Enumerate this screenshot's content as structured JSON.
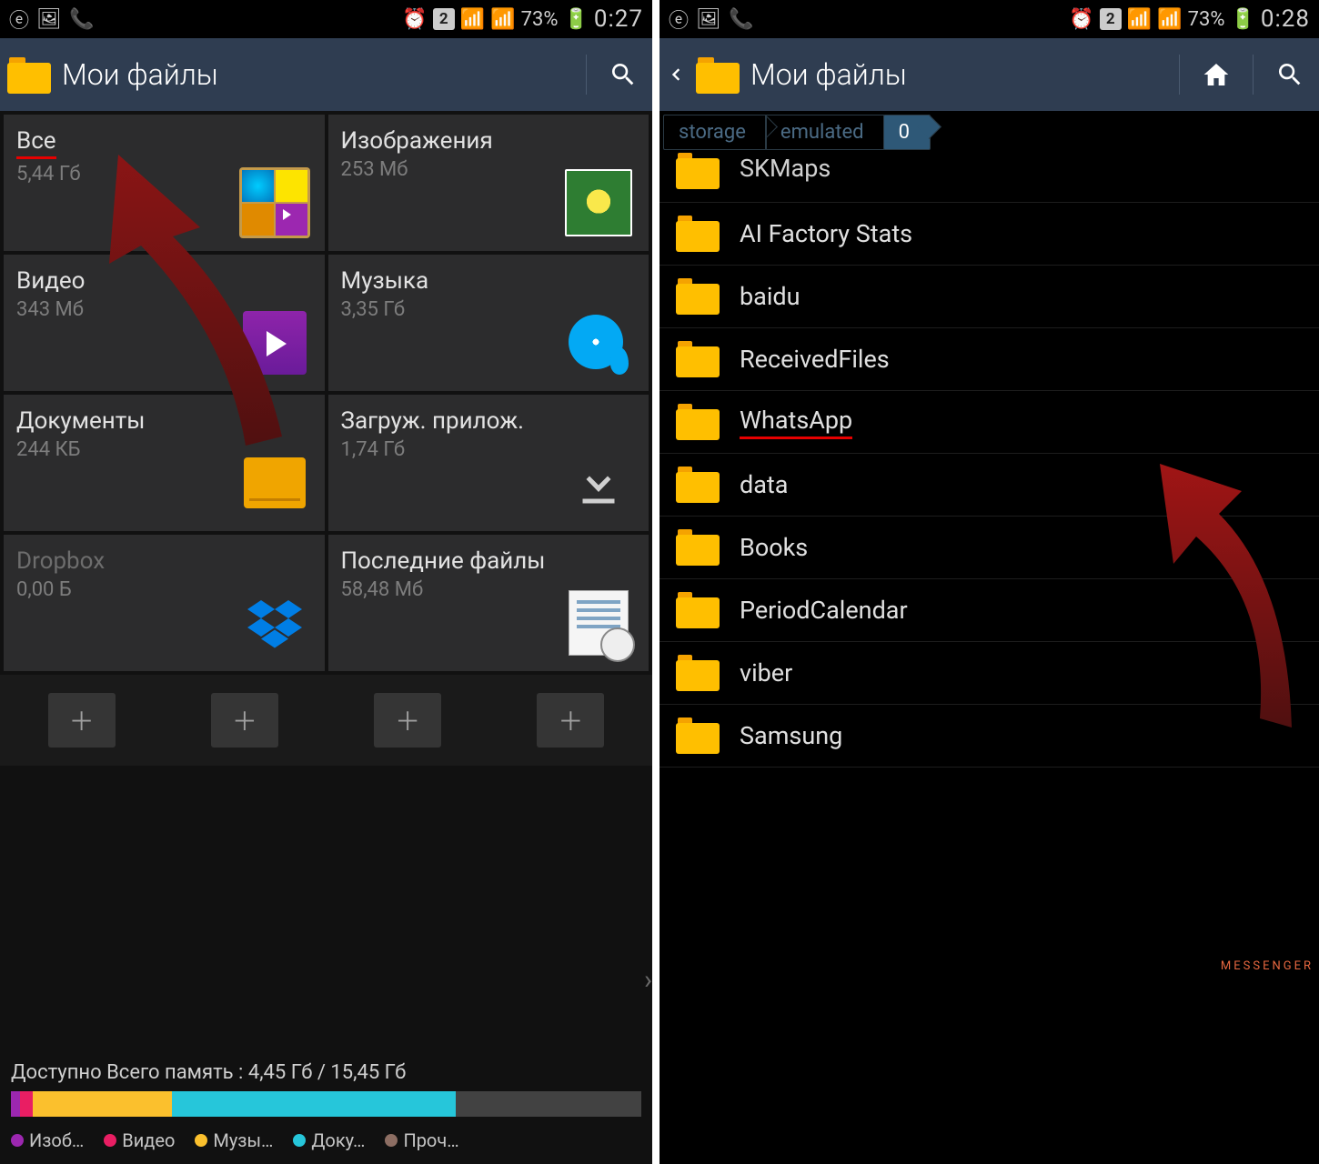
{
  "status": {
    "battery": "73%",
    "time_left": "0:27",
    "time_right": "0:28",
    "sim": "2"
  },
  "app": {
    "title": "Мои файлы"
  },
  "tiles": [
    {
      "title": "Все",
      "size": "5,44 Гб"
    },
    {
      "title": "Изображения",
      "size": "253 Мб"
    },
    {
      "title": "Видео",
      "size": "343 Мб"
    },
    {
      "title": "Музыка",
      "size": "3,35 Гб"
    },
    {
      "title": "Документы",
      "size": "244 КБ"
    },
    {
      "title": "Загруж. прилож.",
      "size": "1,74 Гб"
    },
    {
      "title": "Dropbox",
      "size": "0,00 Б"
    },
    {
      "title": "Последние файлы",
      "size": "58,48 Мб"
    }
  ],
  "storage": {
    "label": "Доступно Всего память : 4,45 Гб / 15,45 Гб"
  },
  "legend": [
    "Изоб…",
    "Видео",
    "Музы…",
    "Доку…",
    "Проч…"
  ],
  "legend_colors": [
    "#9c27b0",
    "#e91e63",
    "#fbc02d",
    "#26c6da",
    "#8d6e63"
  ],
  "segments": [
    {
      "c": "#9c27b0",
      "w": "1.5%"
    },
    {
      "c": "#e91e63",
      "w": "2%"
    },
    {
      "c": "#fbc02d",
      "w": "22%"
    },
    {
      "c": "#26c6da",
      "w": "45%"
    },
    {
      "c": "#424242",
      "w": "29.5%"
    }
  ],
  "crumbs": [
    "storage",
    "emulated",
    "0"
  ],
  "folders": [
    "SKMaps",
    "AI Factory Stats",
    "baidu",
    "ReceivedFiles",
    "WhatsApp",
    "data",
    "Books",
    "PeriodCalendar",
    "viber",
    "Samsung"
  ],
  "watermark": "MESSENGER"
}
